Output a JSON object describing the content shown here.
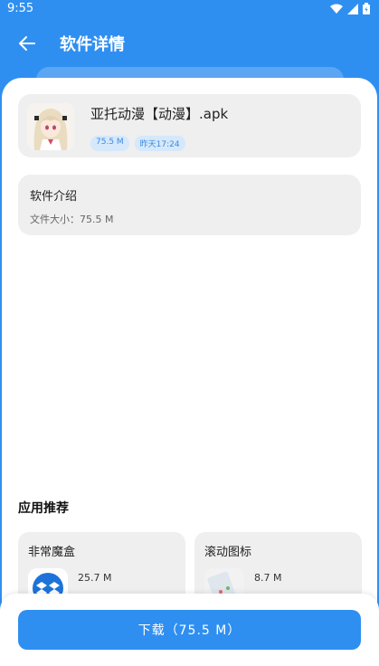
{
  "status": {
    "time": "9:55"
  },
  "header": {
    "title": "软件详情"
  },
  "file": {
    "name": "亚托动漫【动漫】.apk",
    "size_tag": "75.5 M",
    "date_tag": "昨天17:24"
  },
  "info": {
    "title": "软件介绍",
    "size_text": "文件大小：75.5 M"
  },
  "recommend": {
    "title": "应用推荐",
    "items": [
      {
        "name": "非常魔盒",
        "size": "25.7 M"
      },
      {
        "name": "滚动图标",
        "size": "8.7 M"
      }
    ]
  },
  "download": {
    "label": "下载（75.5 M）"
  },
  "colors": {
    "primary": "#2f8ff0",
    "card": "#efefef",
    "tag_bg": "#d6e8fb"
  }
}
